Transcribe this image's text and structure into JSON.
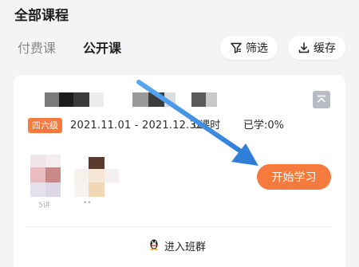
{
  "header": {
    "title": "全部课程"
  },
  "tabs": [
    {
      "label": "付费课",
      "active": false
    },
    {
      "label": "公开课",
      "active": true
    }
  ],
  "actions": {
    "filter_label": "筛选",
    "cache_label": "缓存"
  },
  "course": {
    "badge": "四六级",
    "date_range": "2021.11.01 - 2021.12.31",
    "lessons": "0课时",
    "progress": "已学:0%",
    "teacher_captions": [
      "5讲",
      "••"
    ]
  },
  "start_button": {
    "label": "开始学习"
  },
  "join_group": {
    "label": "进入班群"
  },
  "colors": {
    "accent": "#f47a3d",
    "arrow": "#3d8fe6",
    "background": "#f4f4f6"
  },
  "icons": [
    "filter-icon",
    "download-icon",
    "pin-top-icon",
    "qq-penguin-icon"
  ]
}
